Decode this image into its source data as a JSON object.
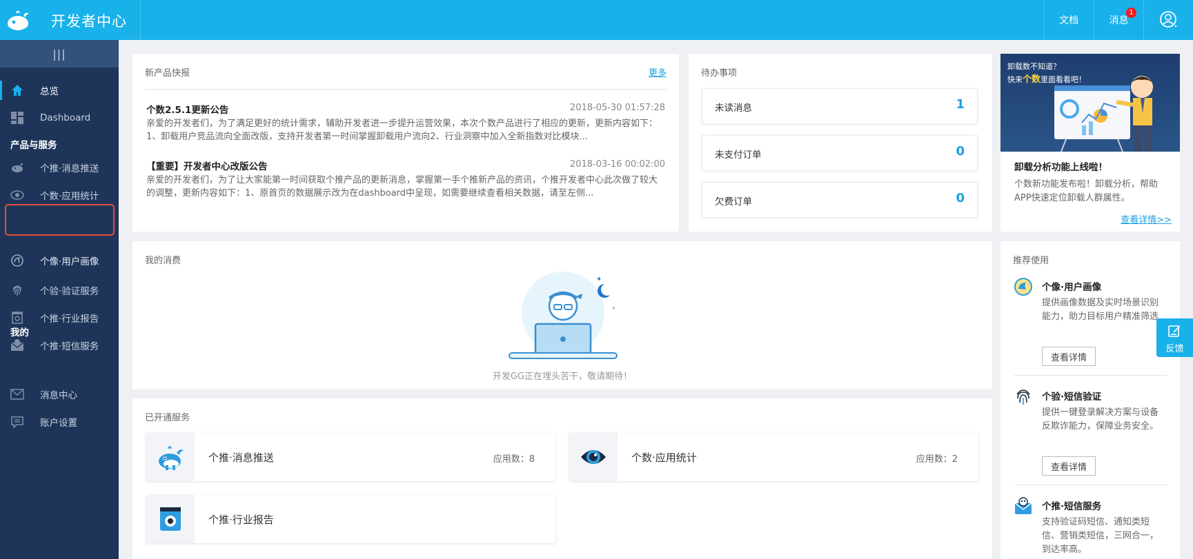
{
  "app": {
    "title": "开发者中心"
  },
  "topbar": {
    "docs": "文档",
    "messages": "消息",
    "message_badge": "1"
  },
  "sidebar": {
    "collapse_glyph": "|||",
    "items": [
      {
        "label": "总览",
        "icon": "home-icon"
      },
      {
        "label": "Dashboard",
        "icon": "dashboard-icon"
      },
      {
        "label": "个推·消息推送",
        "icon": "push-whale-icon"
      },
      {
        "label": "个数·应用统计",
        "icon": "eye-icon"
      },
      {
        "label": "个像·用户画像",
        "icon": "portrait-icon"
      },
      {
        "label": "个验·验证服务",
        "icon": "fingerprint-icon"
      },
      {
        "label": "个推·行业报告",
        "icon": "report-icon"
      },
      {
        "label": "个推·短信服务",
        "icon": "sms-icon"
      },
      {
        "label": "消息中心",
        "icon": "envelope-icon"
      },
      {
        "label": "账户设置",
        "icon": "settings-icon"
      }
    ],
    "section_products": "产品与服务",
    "section_mine": "我的"
  },
  "news": {
    "title": "新产品快报",
    "more": "更多",
    "items": [
      {
        "title": "个数2.5.1更新公告",
        "time": "2018-05-30 01:57:28",
        "body": "亲爱的开发者们，为了满足更好的统计需求，辅助开发者进一步提升运营效果，本次个数产品进行了相应的更新，更新内容如下：1、卸载用户竞品流向全面改版，支持开发者第一时间掌握卸载用户流向2、行业洞察中加入全新指数对比模块..."
      },
      {
        "title": "【重要】开发者中心改版公告",
        "time": "2018-03-16 00:02:00",
        "body": "亲爱的开发者们，为了让大家能第一时间获取个推产品的更新消息，掌握第一手个推新产品的资讯，个推开发者中心此次做了较大的调整，更新内容如下：1、原首页的数据展示改为在dashboard中呈现，如需要继续查看相关数据，请至左侧..."
      }
    ]
  },
  "todo": {
    "title": "待办事项",
    "items": [
      {
        "label": "未读消息",
        "count": "1"
      },
      {
        "label": "未支付订单",
        "count": "0"
      },
      {
        "label": "欠费订单",
        "count": "0"
      }
    ]
  },
  "ad": {
    "banner_line1": "卸载数不知道？",
    "banner_line2_prefix": "快来",
    "banner_line2_highlight": "个数",
    "banner_line2_suffix": "里面看看吧！",
    "title": "卸载分析功能上线啦！",
    "desc": "个数新功能发布啦！卸载分析，帮助APP快速定位卸载人群属性。",
    "link": "查看详情>>"
  },
  "consumption": {
    "title": "我的消费",
    "placeholder": "开发GG正在埋头苦干，敬请期待！"
  },
  "services": {
    "title": "已开通服务",
    "items": [
      {
        "name": "个推·消息推送",
        "meta": "应用数：8",
        "icon": "push-whale-icon"
      },
      {
        "name": "个数·应用统计",
        "meta": "应用数：2",
        "icon": "eye-icon"
      },
      {
        "name": "个推·行业报告",
        "meta": "",
        "icon": "report-icon"
      }
    ]
  },
  "recommend": {
    "title": "推荐使用",
    "items": [
      {
        "title": "个像·用户画像",
        "desc": "提供画像数据及实时场景识别能力，助力目标用户精准筛选",
        "button": "查看详情",
        "icon": "portrait-icon"
      },
      {
        "title": "个验·短信验证",
        "desc": "提供一键登录解决方案与设备反欺诈能力，保障业务安全。",
        "button": "查看详情",
        "icon": "fingerprint-icon"
      },
      {
        "title": "个推·短信服务",
        "desc": "支持验证码短信、通知类短信、营销类短信，三网合一，到达率高。",
        "icon": "sms-icon"
      }
    ]
  },
  "feedback": {
    "label": "反馈"
  },
  "colors": {
    "accent": "#19b1ea",
    "sidebar": "#1e3559",
    "badge": "#f21d1d"
  }
}
